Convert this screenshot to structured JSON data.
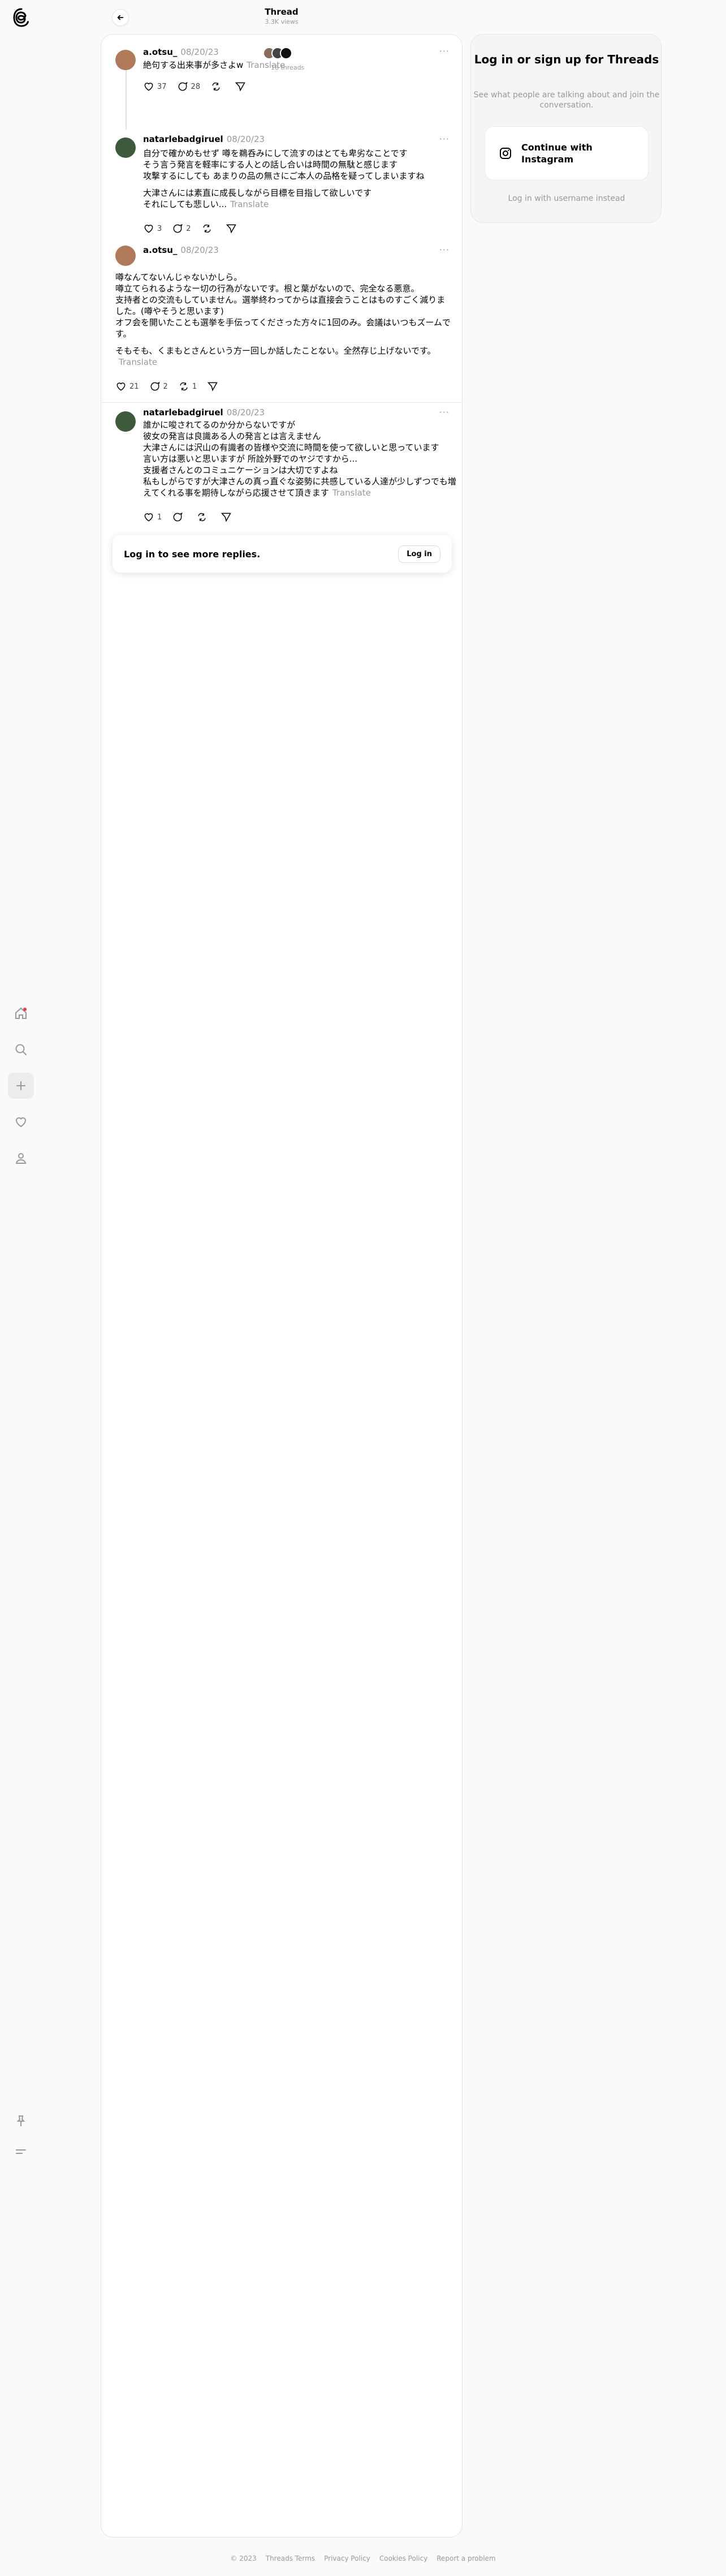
{
  "header": {
    "title": "Thread",
    "subtitle": "3.3K views"
  },
  "facepile": {
    "label": "18 threads"
  },
  "posts": [
    {
      "user": "a.otsu_",
      "date": "08/20/23",
      "body": "絶句する出来事が多さよw",
      "translate": "Translate",
      "likes": "37",
      "replies": "28",
      "reposts": "",
      "avatar_color": "#b07a5a"
    },
    {
      "user": "natarlebadgiruel",
      "date": "08/20/23",
      "paras": [
        "自分で確かめもせず 噂を鵜呑みにして流すのはとても卑劣なことです\nそう言う発言を軽率にする人との話し合いは時間の無駄と感じます\n攻撃するにしても あまりの品の無さにご本人の品格を疑ってしまいますね",
        "大津さんには素直に成長しながら目標を目指して欲しいです\nそれにしても悲しい..."
      ],
      "translate": "Translate",
      "likes": "3",
      "replies": "2",
      "reposts": "",
      "avatar_color": "#3d5a3a"
    },
    {
      "user": "a.otsu_",
      "date": "08/20/23",
      "paras": [
        "噂なんてないんじゃないかしら。\n噂立てられるようなー切の行為がないです。根と葉がないので、完全なる悪意。\n支持者との交流もしていません。選挙終わってからは直接会うことはものすごく減りました。(噂やそうと思います)\nオフ会を開いたことも選挙を手伝ってくださった方々に1回のみ。会議はいつもズームです。",
        "そもそも、くまもとさんという方ー回しか話したことない。全然存じ上げないです。"
      ],
      "translate": "Translate",
      "likes": "21",
      "replies": "2",
      "reposts": "1",
      "avatar_color": "#b07a5a"
    },
    {
      "user": "natarlebadgiruel",
      "date": "08/20/23",
      "body": "誰かに唆されてるのか分からないですが\n彼女の発言は良識ある人の発言とは言えません\n大津さんには沢山の有識者の皆様や交流に時間を使って欲しいと思っています\n言い方は悪いと思いますが 所詮外野でのヤジですから...\n支援者さんとのコミュニケーションは大切ですよね\n私もしがらですが大津さんの真っ直ぐな姿勢に共感している人達が少しずつでも増えてくれる事を期待しながら応援させて頂きます",
      "translate": "Translate",
      "likes": "1",
      "replies": "",
      "reposts": "",
      "avatar_color": "#3d5a3a"
    }
  ],
  "login_bar": {
    "text": "Log in to see more replies.",
    "button": "Log in"
  },
  "sidebar": {
    "title": "Log in or sign up for Threads",
    "subtitle": "See what people are talking about and join the conversation.",
    "instagram_button": "Continue with Instagram",
    "alt_login": "Log in with username instead"
  },
  "footer": [
    "© 2023",
    "Threads Terms",
    "Privacy Policy",
    "Cookies Policy",
    "Report a problem"
  ]
}
